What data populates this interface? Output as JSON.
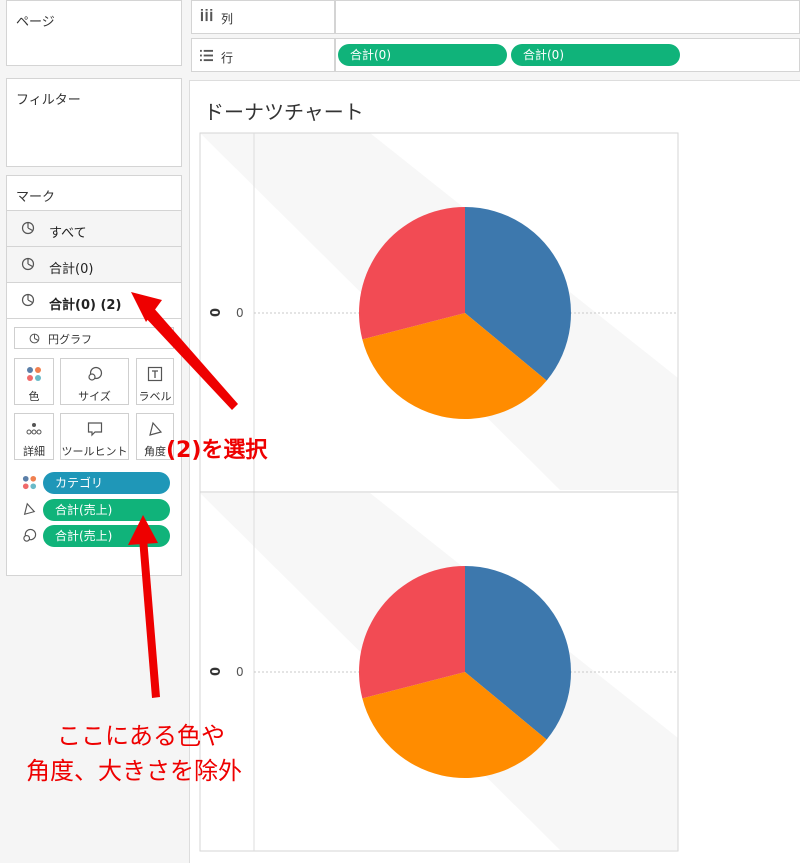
{
  "panels": {
    "pages": "ページ",
    "filters": "フィルター",
    "marks": "マーク"
  },
  "marks": {
    "rows": [
      {
        "label": "すべて",
        "bold": false
      },
      {
        "label": "合計(0)",
        "bold": false
      },
      {
        "label": "合計(0) (2)",
        "bold": true
      }
    ],
    "mark_type": "円グラフ",
    "tiles": [
      "色",
      "サイズ",
      "ラベル",
      "詳細",
      "ツールヒント",
      "角度"
    ],
    "fields": [
      {
        "label": "カテゴリ",
        "icon": "color-dots-icon",
        "color": "#1f97b8"
      },
      {
        "label": "合計(売上)",
        "icon": "angle-icon",
        "color": "#10b37a"
      },
      {
        "label": "合計(売上)",
        "icon": "size-icon",
        "color": "#10b37a"
      }
    ]
  },
  "shelves": {
    "columns_label": "列",
    "rows_label": "行",
    "row_pills": [
      "合計(0)",
      "合計(0)"
    ]
  },
  "sheet": {
    "title": "ドーナツチャート",
    "axis_tick": "0",
    "axis_label": "0"
  },
  "chart_data": {
    "type": "pie",
    "categories": [
      "blue",
      "orange",
      "red"
    ],
    "series": [
      {
        "values": [
          36,
          35,
          29
        ]
      },
      {
        "values": [
          36,
          35,
          29
        ]
      }
    ],
    "colors": [
      "#3d78ad",
      "#ff8c00",
      "#f24b54"
    ]
  },
  "annotations": {
    "select_note": "(2)を選択",
    "remove_note_line1": "ここにある色や",
    "remove_note_line2": "角度、大きさを除外"
  },
  "colors": {
    "pill_green": "#10b37a",
    "pill_blue": "#1f97b8",
    "arrow_red": "#ee0000"
  }
}
